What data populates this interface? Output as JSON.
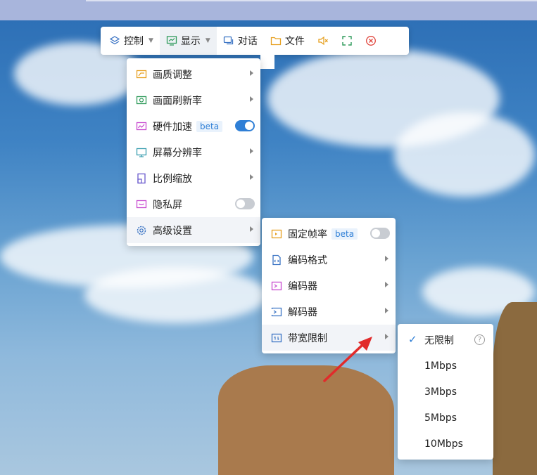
{
  "toolbar": {
    "items": [
      {
        "label": "控制",
        "icon": "layers-icon",
        "has_caret": true
      },
      {
        "label": "显示",
        "icon": "monitor-chart-icon",
        "has_caret": true,
        "active": true
      },
      {
        "label": "对话",
        "icon": "chat-icon"
      },
      {
        "label": "文件",
        "icon": "folder-icon"
      }
    ],
    "icons": [
      "mute-icon",
      "fullscreen-icon",
      "close-circle-icon"
    ]
  },
  "display_menu": {
    "items": [
      {
        "label": "画质调整",
        "icon": "picture-quality-icon",
        "submenu": true
      },
      {
        "label": "画面刷新率",
        "icon": "refresh-rate-icon",
        "submenu": true
      },
      {
        "label": "硬件加速",
        "icon": "hardware-accel-icon",
        "badge": "beta",
        "toggle": "on"
      },
      {
        "label": "屏幕分辨率",
        "icon": "resolution-icon",
        "submenu": true
      },
      {
        "label": "比例缩放",
        "icon": "scale-icon",
        "submenu": true
      },
      {
        "label": "隐私屏",
        "icon": "privacy-screen-icon",
        "toggle": "off"
      },
      {
        "label": "高级设置",
        "icon": "settings-gear-icon",
        "submenu": true
      }
    ]
  },
  "advanced_menu": {
    "items": [
      {
        "label": "固定帧率",
        "icon": "fixed-framerate-icon",
        "badge": "beta",
        "toggle": "off"
      },
      {
        "label": "编码格式",
        "icon": "encode-format-icon",
        "submenu": true
      },
      {
        "label": "编码器",
        "icon": "encoder-icon",
        "submenu": true
      },
      {
        "label": "解码器",
        "icon": "decoder-icon",
        "submenu": true
      },
      {
        "label": "带宽限制",
        "icon": "bandwidth-icon",
        "submenu": true
      }
    ]
  },
  "bandwidth_menu": {
    "items": [
      {
        "label": "无限制",
        "selected": true
      },
      {
        "label": "1Mbps"
      },
      {
        "label": "3Mbps"
      },
      {
        "label": "5Mbps"
      },
      {
        "label": "10Mbps"
      }
    ]
  },
  "colors": {
    "accent": "#2f7fd6",
    "close_red": "#e0443b",
    "arrow_red": "#e12b2b"
  }
}
